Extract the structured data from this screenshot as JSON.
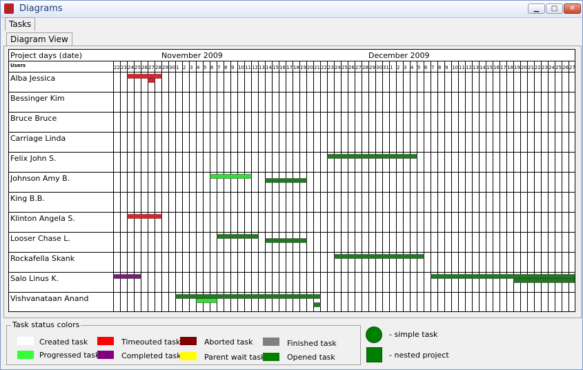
{
  "window": {
    "title": "Diagrams",
    "minimize_glyph": "▁",
    "maximize_glyph": "□",
    "close_glyph": "✕",
    "app_icon": "book-icon"
  },
  "tabs": {
    "outer": "Tasks",
    "inner": "Diagram View"
  },
  "gantt": {
    "header_label": "Project days (date)",
    "users_label": "Users",
    "months": [
      "November 2009",
      "December 2009"
    ],
    "days": [
      "22",
      "23",
      "24",
      "25",
      "26",
      "27",
      "28",
      "29",
      "30",
      "1",
      "2",
      "3",
      "4",
      "5",
      "6",
      "7",
      "8",
      "9",
      "10",
      "11",
      "12",
      "13",
      "14",
      "15",
      "16",
      "17",
      "18",
      "19",
      "20",
      "21",
      "22",
      "23",
      "24",
      "25",
      "26",
      "27",
      "28",
      "29",
      "30",
      "31",
      "1",
      "2",
      "3",
      "4",
      "5",
      "6",
      "7",
      "8",
      "9",
      "10",
      "11",
      "12",
      "13",
      "14",
      "15",
      "16",
      "17",
      "18",
      "19",
      "20",
      "21",
      "22",
      "23",
      "24",
      "25",
      "26",
      "27",
      "28",
      "29",
      "30",
      "31"
    ],
    "users": [
      "Alba Jessica",
      "Bessinger Kim",
      "Bruce Bruce",
      "Carriage Linda",
      "Felix John S.",
      "Johnson Amy B.",
      "King B.B.",
      "Klinton Angela S.",
      "Looser Chase L.",
      "Rockafella Skank",
      "Salo Linus K.",
      "Vishvanataan Anand"
    ],
    "tasks": [
      {
        "row": 0,
        "start": 2,
        "end": 7,
        "status": "timeouted",
        "shape": "simple"
      },
      {
        "row": 0,
        "start": 5,
        "end": 6,
        "status": "timeouted",
        "shape": "simple",
        "level": 2
      },
      {
        "row": 4,
        "start": 31,
        "end": 44,
        "status": "opened",
        "shape": "simple"
      },
      {
        "row": 5,
        "start": 14,
        "end": 20,
        "status": "progressed",
        "shape": "simple"
      },
      {
        "row": 5,
        "start": 22,
        "end": 28,
        "status": "opened",
        "shape": "simple",
        "level": 2
      },
      {
        "row": 7,
        "start": 2,
        "end": 7,
        "status": "timeouted",
        "shape": "simple"
      },
      {
        "row": 8,
        "start": 15,
        "end": 21,
        "status": "opened",
        "shape": "simple"
      },
      {
        "row": 8,
        "start": 22,
        "end": 28,
        "status": "opened",
        "shape": "simple",
        "level": 2
      },
      {
        "row": 9,
        "start": 32,
        "end": 45,
        "status": "opened",
        "shape": "simple"
      },
      {
        "row": 10,
        "start": 0,
        "end": 4,
        "status": "completed",
        "shape": "simple"
      },
      {
        "row": 10,
        "start": 46,
        "end": 67,
        "status": "opened",
        "shape": "simple"
      },
      {
        "row": 10,
        "start": 58,
        "end": 67,
        "status": "opened",
        "shape": "simple",
        "level": 2
      },
      {
        "row": 11,
        "start": 9,
        "end": 30,
        "status": "opened",
        "shape": "simple"
      },
      {
        "row": 11,
        "start": 12,
        "end": 15,
        "status": "progressed",
        "shape": "simple",
        "level": 2
      },
      {
        "row": 11,
        "start": 29,
        "end": 30,
        "status": "opened",
        "shape": "simple",
        "level": 3
      }
    ]
  },
  "legend": {
    "title": "Task status colors",
    "items": [
      {
        "label": "Created task",
        "color": "#ffffff"
      },
      {
        "label": "Progressed task",
        "color": "#33ff33"
      },
      {
        "label": "Timeouted task",
        "color": "#ff0000"
      },
      {
        "label": "Completed task",
        "color": "#800080"
      },
      {
        "label": "Aborted task",
        "color": "#800000"
      },
      {
        "label": "Parent wait task",
        "color": "#ffff00"
      },
      {
        "label": "Finished task",
        "color": "#808080"
      },
      {
        "label": "Opened task",
        "color": "#008000"
      }
    ],
    "shapes": [
      {
        "label": "-  simple task"
      },
      {
        "label": "-  nested project"
      }
    ]
  },
  "status_colors": {
    "timeouted": "#e0202a",
    "opened": "#1f7a1f",
    "progressed": "#33dd33",
    "completed": "#7a1a7a"
  }
}
